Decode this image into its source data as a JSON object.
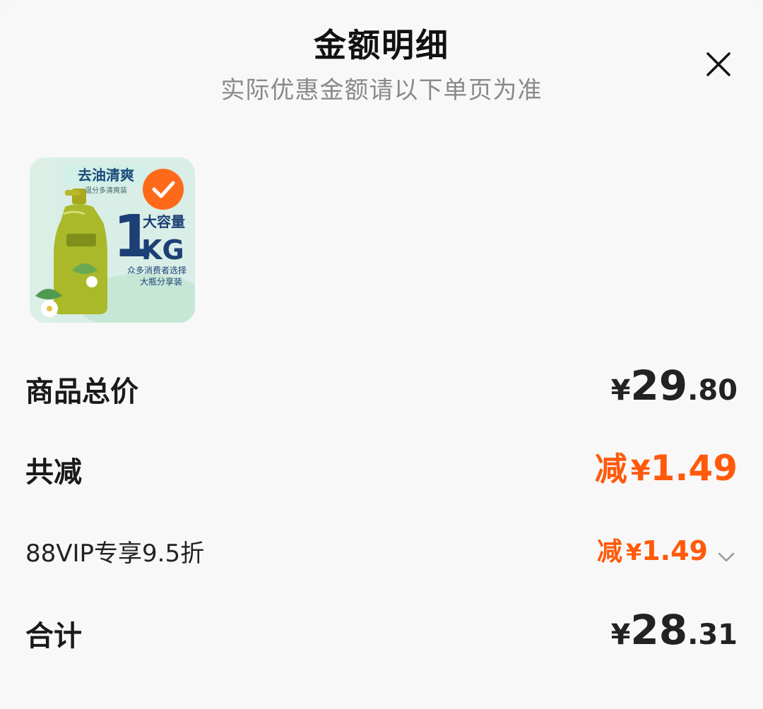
{
  "header": {
    "title": "金额明细",
    "subtitle": "实际优惠金额请以下单页为准"
  },
  "product": {
    "badge_title": "去油清爽",
    "badge_sub": "温分多清爽装",
    "size_label": "大容量",
    "size_number": "1",
    "size_unit": "KG",
    "tagline1": "众多消费者选择",
    "tagline2": "大瓶分享装",
    "selected": true
  },
  "rows": {
    "total_label": "商品总价",
    "total_yen": "¥",
    "total_int": "29",
    "total_dec": ".80",
    "discount_label": "共减",
    "discount_prefix": "减",
    "discount_yen": "¥",
    "discount_value": "1.49",
    "vip_label": "88VIP专享9.5折",
    "vip_prefix": "减",
    "vip_yen": "¥",
    "vip_value": "1.49",
    "sum_label": "合计",
    "sum_yen": "¥",
    "sum_int": "28",
    "sum_dec": ".31"
  },
  "colors": {
    "accent": "#ff5a0c",
    "text": "#1a1a1a",
    "muted": "#8a8a8a"
  }
}
